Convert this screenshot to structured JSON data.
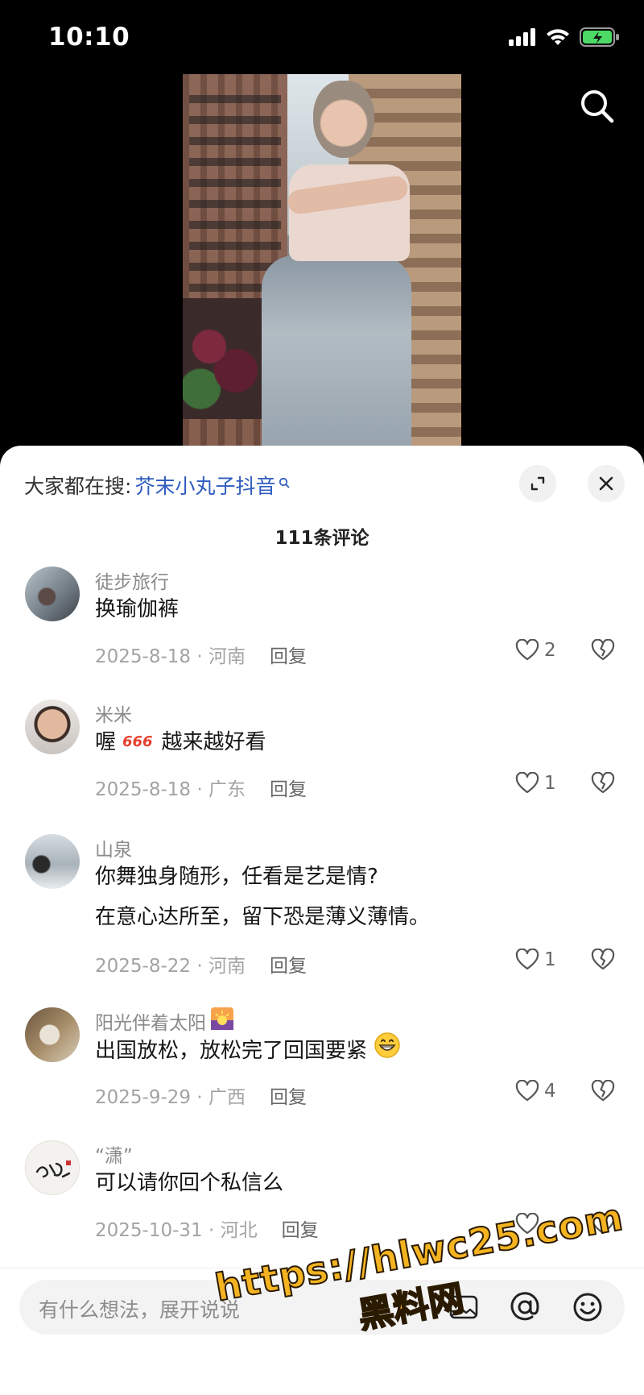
{
  "status_bar": {
    "time": "10:10"
  },
  "panel": {
    "hot_search_label": "大家都在搜:",
    "hot_search_keyword": "芥末小丸子抖音",
    "comment_count": "111条评论"
  },
  "comments": [
    {
      "user": "徒步旅行",
      "text": "换瑜伽裤",
      "date_loc": "2025-8-18 · 河南",
      "reply": "回复",
      "likes": "2"
    },
    {
      "user": "米米",
      "text_before": "喔",
      "text_after": "越来越好看",
      "date_loc": "2025-8-18 · 广东",
      "reply": "回复",
      "likes": "1"
    },
    {
      "user": "山泉",
      "text_line1": "你舞独身随形，任看是艺是情?",
      "text_line2": "在意心达所至，留下恐是薄义薄情。",
      "date_loc": "2025-8-22 · 河南",
      "reply": "回复",
      "likes": "1"
    },
    {
      "user": "阳光伴着太阳",
      "text": "出国放松，放松完了回国要紧",
      "date_loc": "2025-9-29 · 广西",
      "reply": "回复",
      "likes": "4"
    },
    {
      "user": "“潇”",
      "text": "可以请你回个私信么",
      "date_loc": "2025-10-31 · 河北",
      "reply": "回复",
      "likes": ""
    }
  ],
  "input_bar": {
    "placeholder": "有什么想法，展开说说"
  },
  "watermark": {
    "url": "https://hlwc25.com",
    "name": "黑料网"
  },
  "icons": [
    "search-icon",
    "expand-icon",
    "close-icon",
    "heart-icon",
    "broken-heart-icon",
    "at-icon",
    "emoji-icon",
    "image-icon"
  ],
  "colors": {
    "keyword": "#2f5cbf",
    "watermark": "#f4b320"
  }
}
